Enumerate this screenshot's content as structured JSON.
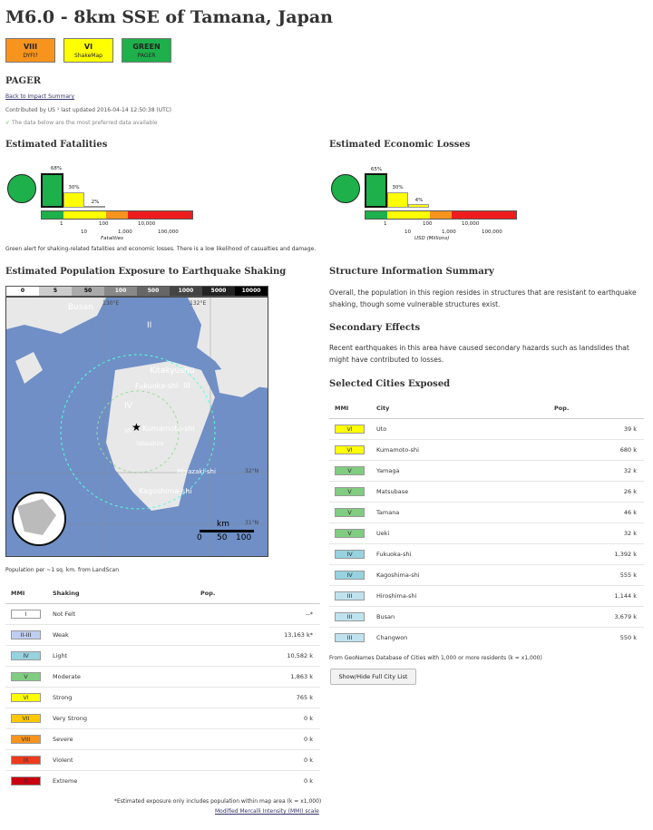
{
  "title": "M6.0 - 8km SSE of Tamana, Japan",
  "badges": [
    {
      "label": "VIII",
      "sub": "DYFI?",
      "color": "#f7941d"
    },
    {
      "label": "VI",
      "sub": "ShakeMap",
      "color": "#ffff00"
    },
    {
      "label": "GREEN",
      "sub": "PAGER",
      "color": "#1eb04b"
    }
  ],
  "pager": {
    "heading": "PAGER",
    "back_link": "Back to Impact Summary",
    "contributed": "Contributed by US ¹ last updated 2016-04-14 12:50:38 (UTC)",
    "preferred": "The data below are the most preferred data available"
  },
  "fatalities": {
    "heading": "Estimated Fatalities",
    "bars": [
      {
        "pct": "68%",
        "value": 68
      },
      {
        "pct": "30%",
        "value": 30
      },
      {
        "pct": "2%",
        "value": 2
      }
    ],
    "ticks_top": [
      "1",
      "100",
      "10,000"
    ],
    "ticks_bottom": [
      "10",
      "1,000",
      "100,000"
    ],
    "axis_label": "Fatalities"
  },
  "losses": {
    "heading": "Estimated Economic Losses",
    "bars": [
      {
        "pct": "65%",
        "value": 65
      },
      {
        "pct": "30%",
        "value": 30
      },
      {
        "pct": "4%",
        "value": 4
      }
    ],
    "ticks_top": [
      "1",
      "100",
      "10,000"
    ],
    "ticks_bottom": [
      "10",
      "1,000",
      "100,000"
    ],
    "axis_label": "USD (Millions)"
  },
  "alert_text": "Green alert for shaking-related fatalities and economic losses. There is a low likelihood of casualties and damage.",
  "exposure": {
    "heading": "Estimated Population Exposure to Earthquake Shaking",
    "scale": [
      "0",
      "5",
      "50",
      "100",
      "500",
      "1000",
      "5000",
      "10000"
    ],
    "map_labels": {
      "busan": "Busan",
      "kitakyushu": "Kitakyushu",
      "fukuoka": "Fukuoka-shi",
      "kumamoto": "Kumamoto-shi",
      "miyazaki": "Miyazaki-shi",
      "kagoshima": "Kagoshima-shi",
      "matsushiro": "Yatsushiro",
      "lon1": "130°E",
      "lon2": "132°E",
      "lat1": "32°N",
      "lat2": "31°N",
      "mmi_iii": "III",
      "mmi_iv": "IV",
      "mmi_vi": "VI",
      "mmi_ii": "II",
      "km": "km",
      "km0": "0",
      "km50": "50",
      "km100": "100"
    },
    "source": "Population per ~1 sq. km. from LandScan"
  },
  "exposure_table": {
    "headers": [
      "MMI",
      "Shaking",
      "Pop."
    ],
    "rows": [
      {
        "mmi": "I",
        "shaking": "Not Felt",
        "pop": "--*",
        "color": "#ffffff"
      },
      {
        "mmi": "II-III",
        "shaking": "Weak",
        "pop": "13,163 k*",
        "color": "#bfcdf0"
      },
      {
        "mmi": "IV",
        "shaking": "Light",
        "pop": "10,582 k",
        "color": "#96d2df"
      },
      {
        "mmi": "V",
        "shaking": "Moderate",
        "pop": "1,863 k",
        "color": "#80cc80"
      },
      {
        "mmi": "VI",
        "shaking": "Strong",
        "pop": "765 k",
        "color": "#ffff00"
      },
      {
        "mmi": "VII",
        "shaking": "Very Strong",
        "pop": "0 k",
        "color": "#ffc800"
      },
      {
        "mmi": "VIII",
        "shaking": "Severe",
        "pop": "0 k",
        "color": "#f7941d"
      },
      {
        "mmi": "IX",
        "shaking": "Violent",
        "pop": "0 k",
        "color": "#ee3b1e"
      },
      {
        "mmi": "X",
        "shaking": "Extreme",
        "pop": "0 k",
        "color": "#c8000f"
      }
    ],
    "footnote": "*Estimated exposure only includes population within map area (k = x1,000)",
    "mmi_link": "Modified Mercalli Intensity (MMI) scale"
  },
  "structure": {
    "heading": "Structure Information Summary",
    "text": "Overall, the population in this region resides in structures that are resistant to earthquake shaking, though some vulnerable structures exist."
  },
  "secondary": {
    "heading": "Secondary Effects",
    "text": "Recent earthquakes in this area have caused secondary hazards such as landslides that might have contributed to losses."
  },
  "cities": {
    "heading": "Selected Cities Exposed",
    "headers": [
      "MMI",
      "City",
      "Pop."
    ],
    "rows": [
      {
        "mmi": "VI",
        "city": "Uto",
        "pop": "39 k",
        "color": "#ffff00"
      },
      {
        "mmi": "VI",
        "city": "Kumamoto-shi",
        "pop": "680 k",
        "color": "#ffff00"
      },
      {
        "mmi": "V",
        "city": "Yamaga",
        "pop": "32 k",
        "color": "#80cc80"
      },
      {
        "mmi": "V",
        "city": "Matsubase",
        "pop": "26 k",
        "color": "#80cc80"
      },
      {
        "mmi": "V",
        "city": "Tamana",
        "pop": "46 k",
        "color": "#80cc80"
      },
      {
        "mmi": "V",
        "city": "Ueki",
        "pop": "32 k",
        "color": "#80cc80"
      },
      {
        "mmi": "IV",
        "city": "Fukuoka-shi",
        "pop": "1,392 k",
        "color": "#96d2df"
      },
      {
        "mmi": "IV",
        "city": "Kagoshima-shi",
        "pop": "555 k",
        "color": "#96d2df"
      },
      {
        "mmi": "III",
        "city": "Hiroshima-shi",
        "pop": "1,144 k",
        "color": "#bfe3ee"
      },
      {
        "mmi": "III",
        "city": "Busan",
        "pop": "3,679 k",
        "color": "#bfe3ee"
      },
      {
        "mmi": "III",
        "city": "Changwon",
        "pop": "550 k",
        "color": "#bfe3ee"
      }
    ],
    "source": "From GeoNames Database of Cities with 1,000 or more residents (k = x1,000)",
    "button": "Show/Hide Full City List"
  }
}
